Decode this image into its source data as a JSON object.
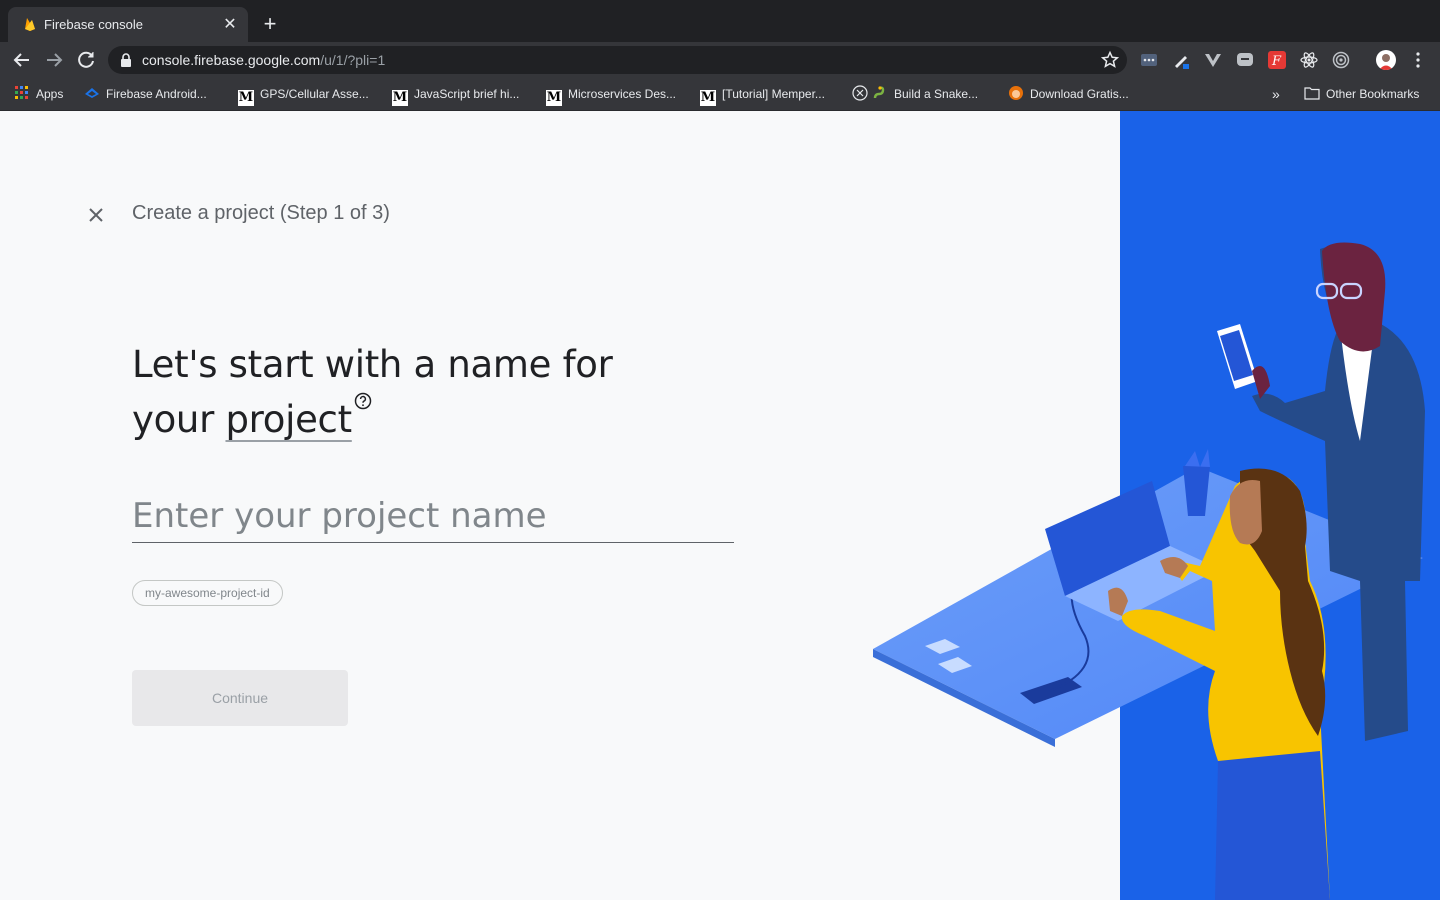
{
  "browser": {
    "tab": {
      "title": "Firebase console",
      "close": "✕"
    },
    "new_tab": "+",
    "url": {
      "domain": "console.firebase.google.com",
      "path": "/u/1/?pli=1"
    },
    "bookmarks": [
      {
        "label": "Apps"
      },
      {
        "label": "Firebase Android..."
      },
      {
        "label": "GPS/Cellular Asse..."
      },
      {
        "label": "JavaScript brief hi..."
      },
      {
        "label": "Microservices Des..."
      },
      {
        "label": "[Tutorial] Memper..."
      },
      {
        "label": "Build a Snake..."
      },
      {
        "label": "Download Gratis..."
      }
    ],
    "overflow": "»",
    "other_bookmarks": "Other Bookmarks"
  },
  "page": {
    "step_title": "Create a project (Step 1 of 3)",
    "headline_part1": "Let's start with a name for",
    "headline_part2": "your ",
    "headline_link": "project",
    "input_placeholder": "Enter your project name",
    "project_id_chip": "my-awesome-project-id",
    "continue_label": "Continue"
  },
  "colors": {
    "accent_blue": "#1a62e8",
    "chrome_dark": "#202124",
    "chrome_toolbar": "#35363a"
  }
}
